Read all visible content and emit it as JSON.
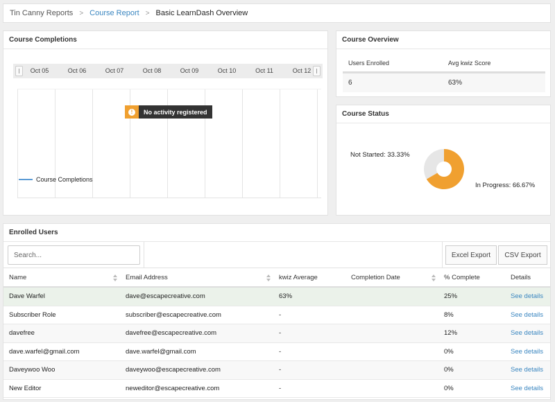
{
  "breadcrumb": {
    "items": [
      {
        "label": "Tin Canny Reports"
      },
      {
        "label": "Course Report"
      },
      {
        "label": "Basic LearnDash Overview"
      }
    ],
    "separator": ">"
  },
  "completions": {
    "title": "Course Completions",
    "timeline_labels": [
      "Oct 05",
      "Oct 06",
      "Oct 07",
      "Oct 08",
      "Oct 09",
      "Oct 10",
      "Oct 11",
      "Oct 12"
    ],
    "empty_message": "No activity registered",
    "warn_icon": "!",
    "legend_label": "Course Completions",
    "legend_color": "#5b9bd5"
  },
  "overview": {
    "title": "Course Overview",
    "headers": [
      "Users Enrolled",
      "Avg kwiz Score"
    ],
    "values": [
      "6",
      "63%"
    ]
  },
  "status": {
    "title": "Course Status",
    "not_started_label": "Not Started: 33.33%",
    "in_progress_label": "In Progress: 66.67%",
    "colors": {
      "not_started": "#e6e6e6",
      "in_progress": "#f0a030"
    }
  },
  "chart_data": {
    "type": "pie",
    "categories": [
      "Not Started",
      "In Progress"
    ],
    "values": [
      33.33,
      66.67
    ]
  },
  "enrolled": {
    "title": "Enrolled Users",
    "search_placeholder": "Search...",
    "excel_label": "Excel Export",
    "csv_label": "CSV Export",
    "columns": [
      "Name",
      "Email Address",
      "kwiz Average",
      "Completion Date",
      "% Complete",
      "Details"
    ],
    "rows": [
      {
        "name": "Dave Warfel",
        "email": "dave@escapecreative.com",
        "kwiz": "63%",
        "date": "",
        "pct": "25%",
        "details": "See details"
      },
      {
        "name": "Subscriber Role",
        "email": "subscriber@escapecreative.com",
        "kwiz": "-",
        "date": "",
        "pct": "8%",
        "details": "See details"
      },
      {
        "name": "davefree",
        "email": "davefree@escapecreative.com",
        "kwiz": "-",
        "date": "",
        "pct": "12%",
        "details": "See details"
      },
      {
        "name": "dave.warfel@gmail.com",
        "email": "dave.warfel@gmail.com",
        "kwiz": "-",
        "date": "",
        "pct": "0%",
        "details": "See details"
      },
      {
        "name": "Daveywoo Woo",
        "email": "daveywoo@escapecreative.com",
        "kwiz": "-",
        "date": "",
        "pct": "0%",
        "details": "See details"
      },
      {
        "name": "New Editor",
        "email": "neweditor@escapecreative.com",
        "kwiz": "-",
        "date": "",
        "pct": "0%",
        "details": "See details"
      }
    ]
  }
}
